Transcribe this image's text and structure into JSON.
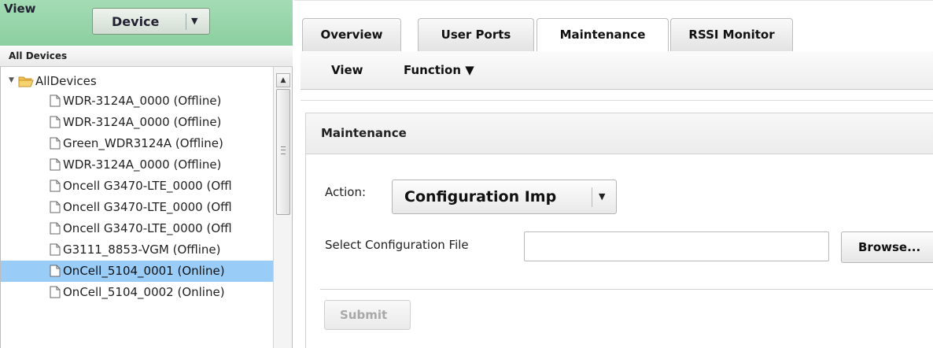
{
  "left_panel": {
    "view_label": "View",
    "device_dropdown": {
      "selected": "Device"
    },
    "all_devices_header": "All Devices",
    "tree": {
      "root_label": "AllDevices",
      "items": [
        {
          "label": "WDR-3124A_0000 (Offline)",
          "selected": false
        },
        {
          "label": "WDR-3124A_0000 (Offline)",
          "selected": false
        },
        {
          "label": "Green_WDR3124A (Offline)",
          "selected": false
        },
        {
          "label": "WDR-3124A_0000 (Offline)",
          "selected": false
        },
        {
          "label": "Oncell G3470-LTE_0000 (Offl",
          "selected": false
        },
        {
          "label": "Oncell G3470-LTE_0000 (Offl",
          "selected": false
        },
        {
          "label": "Oncell G3470-LTE_0000 (Offl",
          "selected": false
        },
        {
          "label": "G3111_8853-VGM (Offline)",
          "selected": false
        },
        {
          "label": "OnCell_5104_0001 (Online)",
          "selected": true
        },
        {
          "label": "OnCell_5104_0002 (Online)",
          "selected": false
        }
      ]
    }
  },
  "right_panel": {
    "tabs": [
      {
        "label": "Overview",
        "active": false
      },
      {
        "label": "User Ports",
        "active": false
      },
      {
        "label": "Maintenance",
        "active": true
      },
      {
        "label": "RSSI Monitor",
        "active": false
      }
    ],
    "submenu": {
      "view_label": "View",
      "function_label": "Function ▼"
    },
    "section_title": "Maintenance",
    "action_label": "Action:",
    "action_dropdown": {
      "selected": "Configuration Imp"
    },
    "file_label": "Select Configuration File",
    "file_input_value": "",
    "browse_label": "Browse...",
    "submit_label": "Submit"
  },
  "colors": {
    "view_bar": "#8ccfa0",
    "selected_row": "#99cdf8",
    "disabled_text": "#a8a8a8"
  }
}
